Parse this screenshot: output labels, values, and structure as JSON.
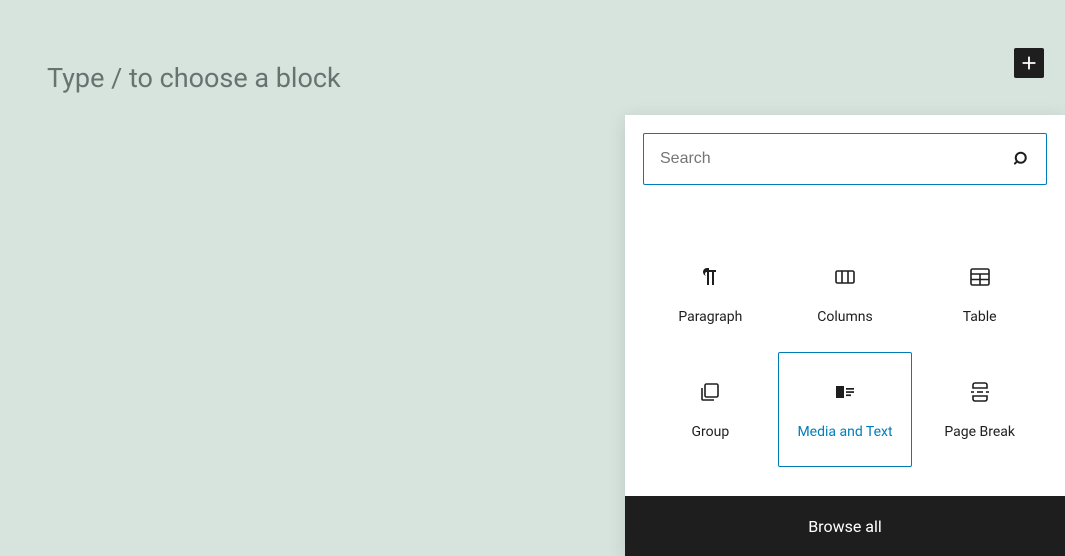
{
  "editor": {
    "placeholder": "Type / to choose a block"
  },
  "inserter": {
    "search_placeholder": "Search",
    "blocks": [
      {
        "name": "paragraph",
        "label": "Paragraph",
        "selected": false
      },
      {
        "name": "columns",
        "label": "Columns",
        "selected": false
      },
      {
        "name": "table",
        "label": "Table",
        "selected": false
      },
      {
        "name": "group",
        "label": "Group",
        "selected": false
      },
      {
        "name": "media-text",
        "label": "Media and Text",
        "selected": true
      },
      {
        "name": "page-break",
        "label": "Page Break",
        "selected": false
      }
    ],
    "browse_all": "Browse all"
  }
}
